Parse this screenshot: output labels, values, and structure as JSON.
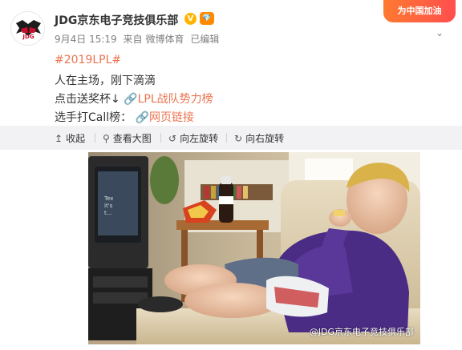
{
  "post": {
    "author": "JDG京东电子竞技俱乐部",
    "verified_mark": "V",
    "vip_mark": "💎",
    "date": "9月4日 15:19",
    "source_prefix": "来自",
    "source": "微博体育",
    "edited": "已编辑",
    "hashtag": "#2019LPL#",
    "text_line1": "人在主场，刚下滴滴",
    "line2_prefix": "点击送奖杯↓",
    "line2_link": "LPL战队势力榜",
    "line3_prefix": "选手打Call榜：",
    "line3_link": "网页链接",
    "badge": "为中国加油"
  },
  "toolbar": {
    "collapse": "收起",
    "view_large": "查看大图",
    "rotate_left": "向左旋转",
    "rotate_right": "向右旋转"
  },
  "image": {
    "watermark": "@JDG京东电子竞技俱乐部",
    "tv_text": "Tex\nit's\nt..."
  },
  "colors": {
    "link": "#eb7350",
    "toolbar_bg": "#f2f2f5",
    "muted": "#808080",
    "brand_badge": "#ff5a3c"
  },
  "icons": [
    "collapse-icon",
    "zoom-icon",
    "rotate-left-icon",
    "rotate-right-icon",
    "link-icon",
    "chevron-down-icon"
  ]
}
